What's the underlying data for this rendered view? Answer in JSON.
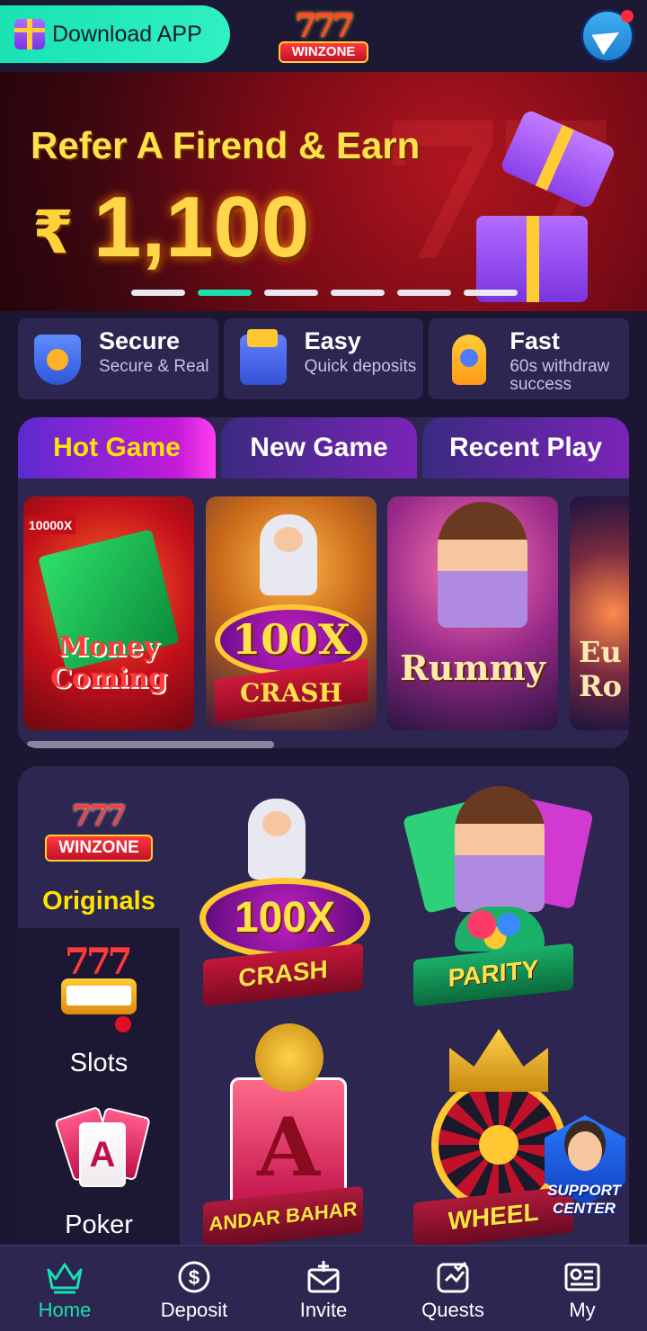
{
  "header": {
    "download_label": "Download APP",
    "logo_sevens": "777",
    "logo_text": "WINZONE"
  },
  "banner": {
    "headline": "Refer A Firend & Earn",
    "currency": "₹",
    "amount": "1,100",
    "slides": 6,
    "active_slide": 2
  },
  "features": [
    {
      "title": "Secure",
      "subtitle": "Secure & Real",
      "icon": "shield-icon"
    },
    {
      "title": "Easy",
      "subtitle": "Quick deposits",
      "icon": "wallet-icon"
    },
    {
      "title": "Fast",
      "subtitle": "60s withdraw success",
      "icon": "rocket-icon"
    }
  ],
  "tabs": [
    {
      "label": "Hot Game",
      "active": true
    },
    {
      "label": "New Game",
      "active": false
    },
    {
      "label": "Recent Play",
      "active": false
    }
  ],
  "hot_games": [
    {
      "title": "Money Coming",
      "badge": "10000X"
    },
    {
      "title": "100X",
      "subtitle": "CRASH"
    },
    {
      "title": "Rummy"
    },
    {
      "title": "Eu Ro"
    }
  ],
  "categories": [
    {
      "label": "Originals",
      "active": true
    },
    {
      "label": "Slots",
      "active": false
    },
    {
      "label": "Poker",
      "active": false
    }
  ],
  "originals": [
    {
      "title": "100X",
      "subtitle": "CRASH"
    },
    {
      "title": "PARITY"
    },
    {
      "title": "ANDAR BAHAR",
      "card": "A"
    },
    {
      "title": "WHEEL"
    }
  ],
  "support": {
    "line1": "SUPPORT",
    "line2": "CENTER"
  },
  "nav": [
    {
      "label": "Home",
      "icon": "crown-icon",
      "active": true
    },
    {
      "label": "Deposit",
      "icon": "dollar-circle-icon",
      "active": false
    },
    {
      "label": "Invite",
      "icon": "invite-mail-icon",
      "active": false
    },
    {
      "label": "Quests",
      "icon": "quests-icon",
      "active": false
    },
    {
      "label": "My",
      "icon": "profile-card-icon",
      "active": false
    }
  ],
  "colors": {
    "accent": "#19e0b0",
    "background": "#1c1632",
    "panel": "#2c2650",
    "highlight": "#ffe400"
  }
}
